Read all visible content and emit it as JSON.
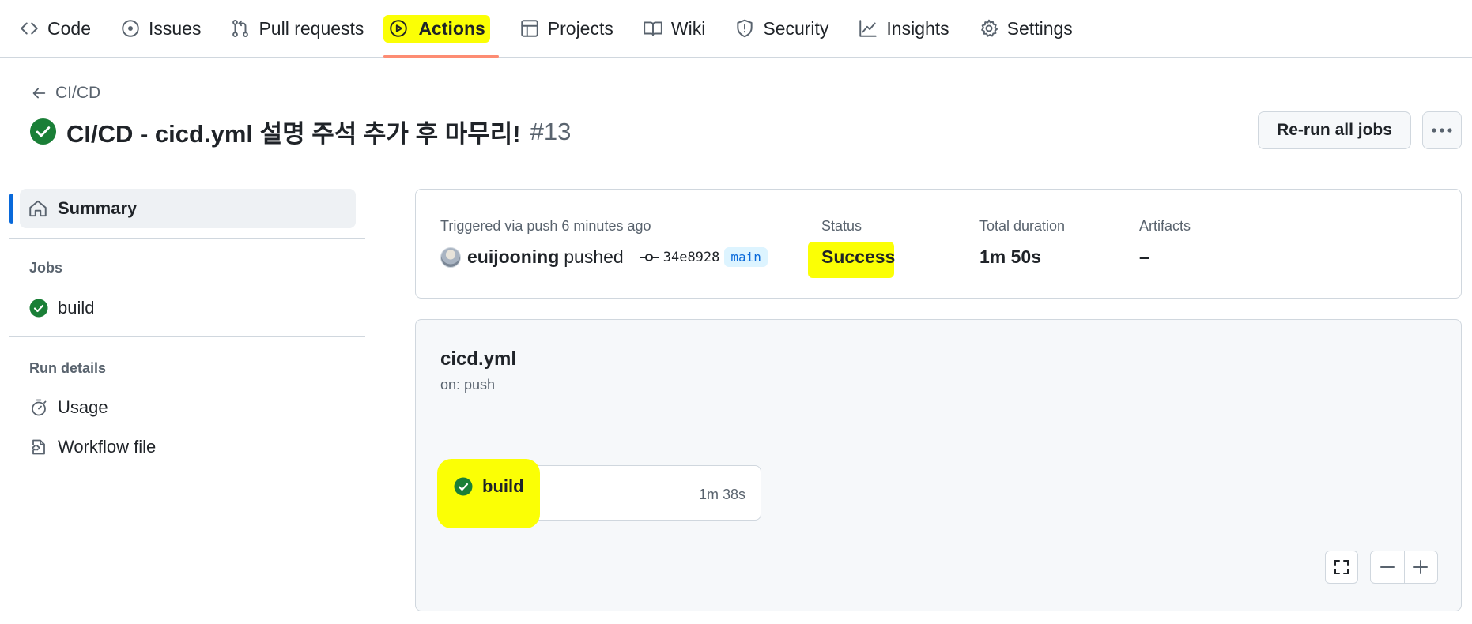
{
  "nav": {
    "tabs": [
      {
        "label": "Code",
        "icon": "code-icon"
      },
      {
        "label": "Issues",
        "icon": "issue-opened-icon"
      },
      {
        "label": "Pull requests",
        "icon": "git-pull-request-icon"
      },
      {
        "label": "Actions",
        "icon": "play-icon",
        "active": true
      },
      {
        "label": "Projects",
        "icon": "table-icon"
      },
      {
        "label": "Wiki",
        "icon": "book-icon"
      },
      {
        "label": "Security",
        "icon": "shield-icon"
      },
      {
        "label": "Insights",
        "icon": "graph-icon"
      },
      {
        "label": "Settings",
        "icon": "gear-icon"
      }
    ],
    "active_underline_color": "#fd8c73",
    "highlight_color": "#fbff05"
  },
  "header": {
    "back_label": "CI/CD",
    "title": "CI/CD - cicd.yml 설명 주석 추가 후 마무리!",
    "run_number": "#13",
    "rerun_label": "Re-run all jobs"
  },
  "sidebar": {
    "summary_label": "Summary",
    "jobs_heading": "Jobs",
    "jobs": [
      {
        "label": "build",
        "status": "success"
      }
    ],
    "run_details_heading": "Run details",
    "usage_label": "Usage",
    "workflow_file_label": "Workflow file"
  },
  "summary": {
    "triggered_label": "Triggered via push 6 minutes ago",
    "actor": "euijooning",
    "action": "pushed",
    "commit": "34e8928",
    "branch": "main",
    "status_label": "Status",
    "status_value": "Success",
    "duration_label": "Total duration",
    "duration_value": "1m 50s",
    "artifacts_label": "Artifacts",
    "artifacts_value": "–"
  },
  "workflow": {
    "name": "cicd.yml",
    "trigger": "on: push",
    "job": {
      "label": "build",
      "duration": "1m 38s",
      "status": "success"
    }
  },
  "colors": {
    "success": "#1a7f37",
    "accent": "#0969da"
  }
}
